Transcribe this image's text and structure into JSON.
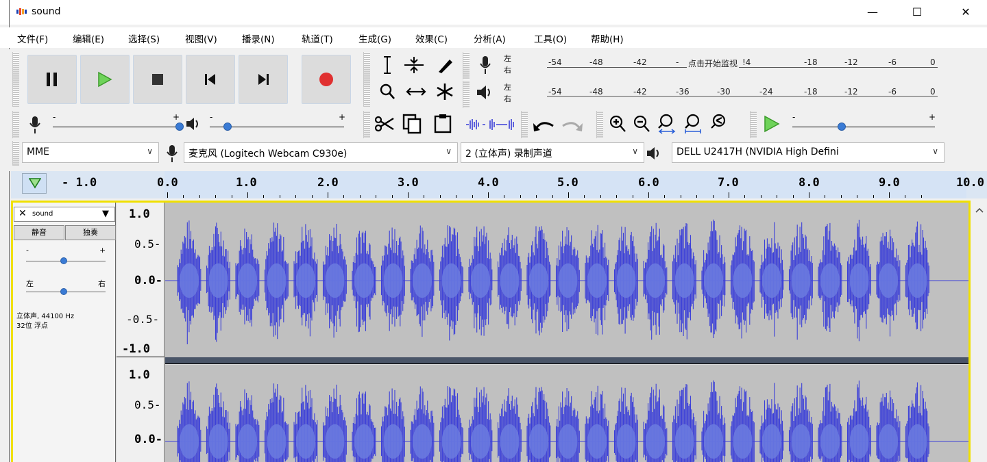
{
  "window": {
    "title": "sound",
    "minimize": "—",
    "maximize": "☐",
    "close": "✕"
  },
  "menu": [
    "文件(F)",
    "编辑(E)",
    "选择(S)",
    "视图(V)",
    "播录(N)",
    "轨道(T)",
    "生成(G)",
    "效果(C)",
    "分析(A)",
    "工具(O)",
    "帮助(H)"
  ],
  "meters": {
    "record_lr": [
      "左",
      "右"
    ],
    "play_lr": [
      "左",
      "右"
    ],
    "record_ticks": [
      "-54",
      "-48",
      "-42",
      "-",
      "!4",
      "-18",
      "-12",
      "-6",
      "0"
    ],
    "record_hint": "点击开始监视",
    "play_ticks": [
      "-54",
      "-48",
      "-42",
      "-36",
      "-30",
      "-24",
      "-18",
      "-12",
      "-6",
      "0"
    ]
  },
  "sliders": {
    "minus": "-",
    "plus": "+"
  },
  "devices": {
    "host": "MME",
    "input": "麦克风 (Logitech Webcam C930e)",
    "channels": "2 (立体声) 录制声道",
    "output": "DELL U2417H (NVIDIA High Defini"
  },
  "timeline": {
    "labels": [
      "- 1.0",
      "0.0",
      "1.0",
      "2.0",
      "3.0",
      "4.0",
      "5.0",
      "6.0",
      "7.0",
      "8.0",
      "9.0",
      "10.0"
    ]
  },
  "track": {
    "name": "sound",
    "close": "✕",
    "menu_arrow": "▼",
    "mute": "静音",
    "solo": "独奏",
    "gain_minus": "-",
    "gain_plus": "+",
    "pan_left": "左",
    "pan_right": "右",
    "info_line1": "立体声, 44100 Hz",
    "info_line2": "32位 浮点"
  },
  "vruler_ch1": [
    "1.0",
    "0.5-",
    "0.0-",
    "-0.5-",
    "-1.0"
  ],
  "vruler_ch2": [
    "1.0",
    "0.5-",
    "0.0-"
  ],
  "colors": {
    "wave": "#3b3fd8",
    "wave_rms": "#6b7be0",
    "track_bg": "#c0c0c0",
    "selection": "#f0e000",
    "record": "#e03030",
    "play": "#4cbb3a"
  }
}
